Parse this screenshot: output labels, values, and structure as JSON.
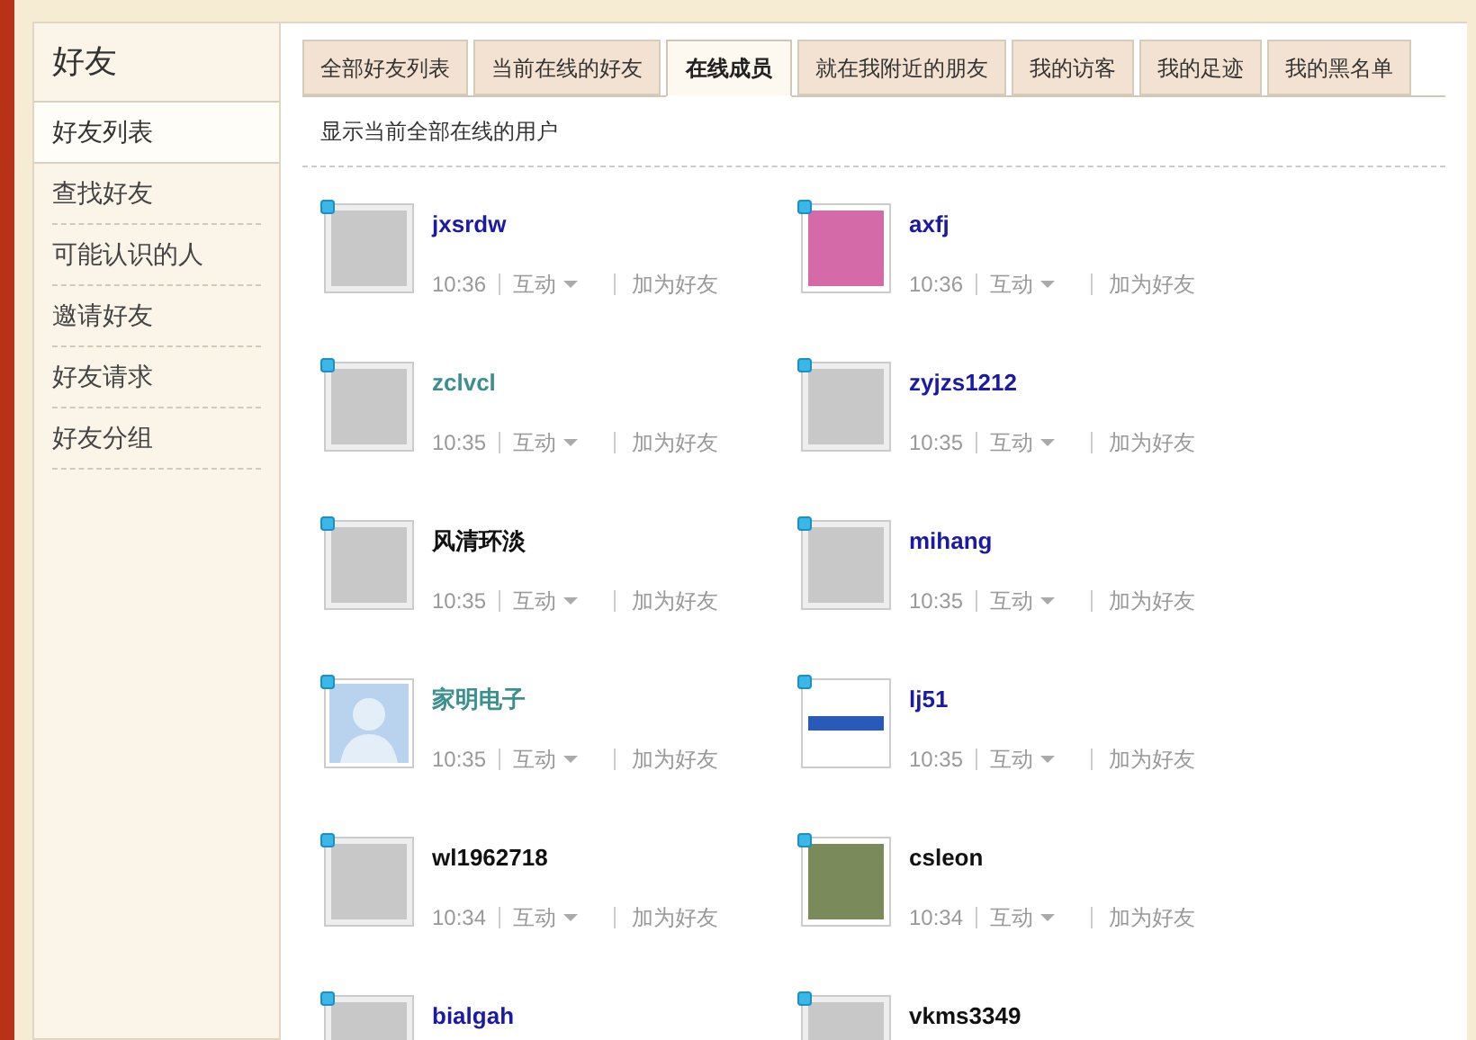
{
  "sidebar": {
    "title": "好友",
    "items": [
      {
        "label": "好友列表",
        "selected": true
      },
      {
        "label": "查找好友",
        "selected": false
      },
      {
        "label": "可能认识的人",
        "selected": false
      },
      {
        "label": "邀请好友",
        "selected": false
      },
      {
        "label": "好友请求",
        "selected": false
      },
      {
        "label": "好友分组",
        "selected": false
      }
    ]
  },
  "tabs": [
    {
      "label": "全部好友列表",
      "selected": false
    },
    {
      "label": "当前在线的好友",
      "selected": false
    },
    {
      "label": "在线成员",
      "selected": true
    },
    {
      "label": "就在我附近的朋友",
      "selected": false
    },
    {
      "label": "我的访客",
      "selected": false
    },
    {
      "label": "我的足迹",
      "selected": false
    },
    {
      "label": "我的黑名单",
      "selected": false
    }
  ],
  "subtitle": "显示当前全部在线的用户",
  "members": [
    {
      "name": "jxsrdw",
      "color": "#1a1aa6",
      "kind": "logo",
      "time": "10:36",
      "interact": "互动",
      "add": "加为好友"
    },
    {
      "name": "axfj",
      "color": "#1a1aa6",
      "kind": "photo",
      "time": "10:36",
      "interact": "互动",
      "add": "加为好友"
    },
    {
      "name": "zclvcl",
      "color": "#3b8f8f",
      "kind": "logo",
      "time": "10:35",
      "interact": "互动",
      "add": "加为好友"
    },
    {
      "name": "zyjzs1212",
      "color": "#1a1aa6",
      "kind": "logo",
      "time": "10:35",
      "interact": "互动",
      "add": "加为好友"
    },
    {
      "name": "风清环淡",
      "color": "#111111",
      "kind": "logo",
      "time": "10:35",
      "interact": "互动",
      "add": "加为好友"
    },
    {
      "name": "mihang",
      "color": "#1a1aa6",
      "kind": "logo",
      "time": "10:35",
      "interact": "互动",
      "add": "加为好友"
    },
    {
      "name": "家明电子",
      "color": "#3b8f8f",
      "kind": "default",
      "time": "10:35",
      "interact": "互动",
      "add": "加为好友"
    },
    {
      "name": "lj51",
      "color": "#1a1aa6",
      "kind": "brand",
      "time": "10:35",
      "interact": "互动",
      "add": "加为好友"
    },
    {
      "name": "wl1962718",
      "color": "#111111",
      "kind": "logo",
      "time": "10:34",
      "interact": "互动",
      "add": "加为好友"
    },
    {
      "name": "csleon",
      "color": "#111111",
      "kind": "landscape",
      "time": "10:34",
      "interact": "互动",
      "add": "加为好友"
    },
    {
      "name": "bialgah",
      "color": "#1a1aa6",
      "kind": "logo"
    },
    {
      "name": "vkms3349",
      "color": "#111111",
      "kind": "logo"
    }
  ]
}
